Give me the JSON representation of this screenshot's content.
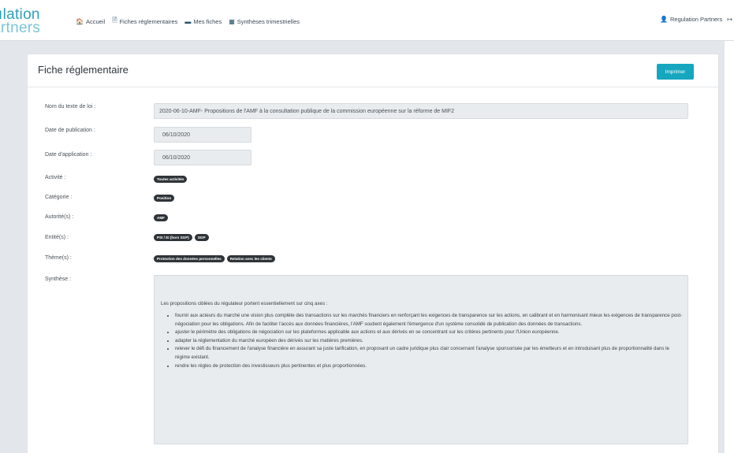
{
  "logo": {
    "line1": "ılation",
    "line2": "artners"
  },
  "nav": {
    "items": [
      {
        "icon": "home-icon",
        "glyph": "🏠",
        "label": "Accueil"
      },
      {
        "icon": "document-icon",
        "glyph": "🗎",
        "label": "Fiches réglementaires"
      },
      {
        "icon": "folder-icon",
        "glyph": "▬",
        "label": "Mes fiches"
      },
      {
        "icon": "calendar-icon",
        "glyph": "▦",
        "label": "Synthèses trimestrielles"
      }
    ],
    "user": {
      "icon": "user-icon",
      "glyph": "👤",
      "label": "Regulation Partners"
    },
    "logout": {
      "icon": "logout-icon",
      "glyph": "↦"
    }
  },
  "card": {
    "title": "Fiche réglementaire",
    "print_label": "Imprimer"
  },
  "fields": {
    "nom": {
      "label": "Nom du texte de loi :",
      "value": "2020-06-10-AMF- Propositions de l'AMF à la consultation publique de la commission européenne sur la réforme de MIF2"
    },
    "date_publication": {
      "label": "Date de publication :",
      "value": "06/10/2020"
    },
    "date_application": {
      "label": "Date d'application :",
      "value": "06/10/2020"
    },
    "activite": {
      "label": "Activité :",
      "badges": [
        "Toutes activités"
      ]
    },
    "categorie": {
      "label": "Catégorie :",
      "badges": [
        "Position"
      ]
    },
    "autorites": {
      "label": "Autorité(s) :",
      "badges": [
        "AMF"
      ]
    },
    "entites": {
      "label": "Entité(s) :",
      "badges": [
        "PSI / EI (hors SGP)",
        "SGP"
      ]
    },
    "themes": {
      "label": "Thème(s) :",
      "badges": [
        "Protection des données personnelles",
        "Relation avec les clients"
      ]
    },
    "synthese": {
      "label": "Synthèse :",
      "intro": "Les propositions ciblées du régulateur portent essentiellement sur cinq axes :",
      "points": [
        "fournir aux acteurs du marché une vision plus complète des transactions sur les marchés financiers en renforçant les exigences de transparence sur les actions, en calibrant et en harmonisant mieux les exigences de transparence post-négociation pour les obligations. Afin de faciliter l'accès aux données financières, l'AMF soutient également l'émergence d'un système consolidé de publication des données de transactions.",
        "ajuster le périmètre des obligations de négociation sur les plateformes applicable aux actions et aux dérivés en se concentrant sur les critères pertinents pour l'Union européenne.",
        "adapter la réglementation du marché européen des dérivés sur les matières premières.",
        "relever le défi du financement de l'analyse financière en assurant sa juste tarification, en proposant un cadre juridique plus clair concernant l'analyse sponsorisée par les émetteurs et en introduisant plus de proportionnalité dans le régime existant.",
        "rendre les règles de protection des investisseurs plus pertinentes et plus proportionnées."
      ]
    }
  }
}
